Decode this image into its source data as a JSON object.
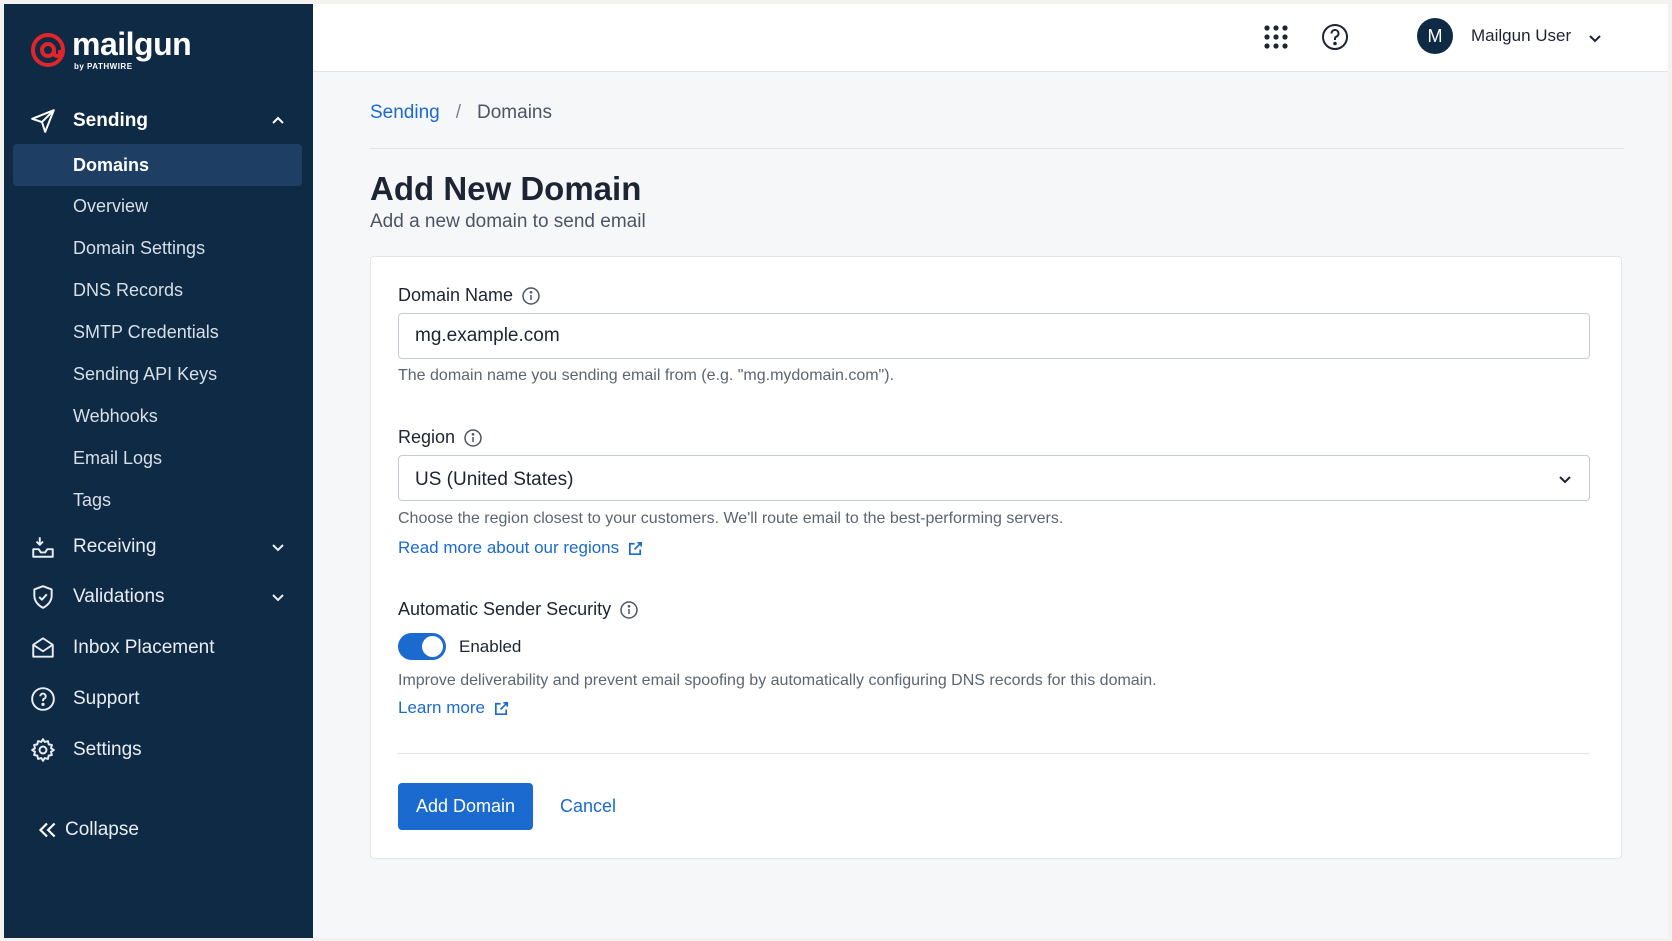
{
  "brand": {
    "name": "mailgun",
    "byline": "by PATHWIRE",
    "accent": "#e0262b"
  },
  "colors": {
    "sidebar_bg": "#0f2a45",
    "primary": "#1a6ad0"
  },
  "sidebar": {
    "sending": {
      "label": "Sending",
      "icon": "send-icon"
    },
    "sending_items": [
      {
        "label": "Domains",
        "active": true
      },
      {
        "label": "Overview"
      },
      {
        "label": "Domain Settings"
      },
      {
        "label": "DNS Records"
      },
      {
        "label": "SMTP Credentials"
      },
      {
        "label": "Sending API Keys"
      },
      {
        "label": "Webhooks"
      },
      {
        "label": "Email Logs"
      },
      {
        "label": "Tags"
      }
    ],
    "receiving": {
      "label": "Receiving",
      "icon": "inbox-icon"
    },
    "validations": {
      "label": "Validations",
      "icon": "shield-check-icon"
    },
    "inbox_placement": {
      "label": "Inbox Placement",
      "icon": "envelope-icon"
    },
    "support": {
      "label": "Support",
      "icon": "help-icon"
    },
    "settings": {
      "label": "Settings",
      "icon": "gear-icon"
    },
    "collapse": {
      "label": "Collapse",
      "icon": "double-chevron-left-icon"
    }
  },
  "topbar": {
    "avatar_initial": "M",
    "user_name": "Mailgun User"
  },
  "breadcrumb": {
    "parent": "Sending",
    "separator": "/",
    "current": "Domains"
  },
  "page": {
    "title": "Add New Domain",
    "subtitle": "Add a new domain to send email"
  },
  "form": {
    "domain_name": {
      "label": "Domain Name",
      "value": "mg.example.com",
      "help": "The domain name you sending email from (e.g. \"mg.mydomain.com\")."
    },
    "region": {
      "label": "Region",
      "value": "US (United States)",
      "help": "Choose the region closest to your customers. We'll route email to the best-performing servers.",
      "link": "Read more about our regions"
    },
    "sender_security": {
      "label": "Automatic Sender Security",
      "toggle_label": "Enabled",
      "enabled": true,
      "help": "Improve deliverability and prevent email spoofing by automatically configuring DNS records for this domain.",
      "link": "Learn more"
    },
    "submit_label": "Add Domain",
    "cancel_label": "Cancel"
  }
}
